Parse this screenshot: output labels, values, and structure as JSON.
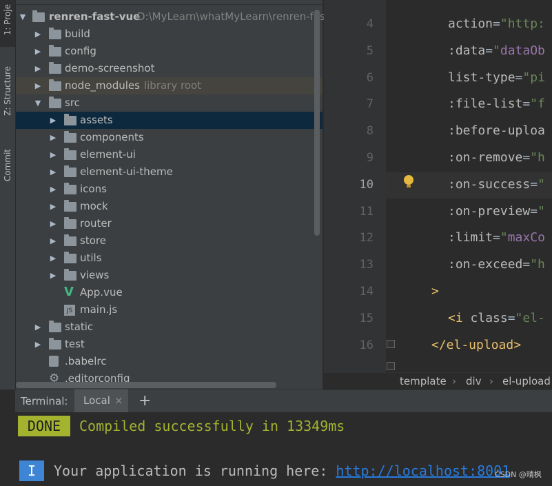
{
  "toolstrip": {
    "tabs": [
      {
        "label": "1: Proje"
      },
      {
        "label": "Z: Structure"
      },
      {
        "label": "Commit"
      }
    ]
  },
  "project": {
    "root": {
      "name": "renren-fast-vue",
      "path": "D:\\MyLearn\\whatMyLearn\\renren-fast"
    },
    "items": [
      {
        "label": "build",
        "kind": "folder"
      },
      {
        "label": "config",
        "kind": "folder"
      },
      {
        "label": "demo-screenshot",
        "kind": "folder"
      },
      {
        "label": "node_modules",
        "kind": "folder",
        "hint": "library root"
      },
      {
        "label": "src",
        "kind": "folder"
      },
      {
        "label": "assets",
        "kind": "folder"
      },
      {
        "label": "components",
        "kind": "folder"
      },
      {
        "label": "element-ui",
        "kind": "folder"
      },
      {
        "label": "element-ui-theme",
        "kind": "folder"
      },
      {
        "label": "icons",
        "kind": "folder"
      },
      {
        "label": "mock",
        "kind": "folder"
      },
      {
        "label": "router",
        "kind": "folder"
      },
      {
        "label": "store",
        "kind": "folder"
      },
      {
        "label": "utils",
        "kind": "folder"
      },
      {
        "label": "views",
        "kind": "folder"
      },
      {
        "label": "App.vue",
        "kind": "vue-file"
      },
      {
        "label": "main.js",
        "kind": "js-file"
      },
      {
        "label": "static",
        "kind": "folder"
      },
      {
        "label": "test",
        "kind": "folder"
      },
      {
        "label": ".babelrc",
        "kind": "config-file"
      },
      {
        "label": ".editorconfig",
        "kind": "gear-file"
      }
    ]
  },
  "editor": {
    "current_line": "10",
    "lines": [
      {
        "num": "4",
        "parts": [
          [
            "attr",
            "action"
          ],
          [
            "eq",
            "="
          ],
          [
            "str",
            "\"http:"
          ]
        ]
      },
      {
        "num": "5",
        "parts": [
          [
            "attr",
            ":data"
          ],
          [
            "eq",
            "="
          ],
          [
            "str",
            "\""
          ],
          [
            "dyn",
            "dataOb"
          ]
        ]
      },
      {
        "num": "6",
        "parts": [
          [
            "attr",
            "list-type"
          ],
          [
            "eq",
            "="
          ],
          [
            "str",
            "\"pi"
          ]
        ]
      },
      {
        "num": "7",
        "parts": [
          [
            "attr",
            ":file-list"
          ],
          [
            "eq",
            "="
          ],
          [
            "str",
            "\"f"
          ]
        ]
      },
      {
        "num": "8",
        "parts": [
          [
            "attr",
            ":before-uploa"
          ]
        ]
      },
      {
        "num": "9",
        "parts": [
          [
            "attr",
            ":on-remove"
          ],
          [
            "eq",
            "="
          ],
          [
            "str",
            "\"h"
          ]
        ]
      },
      {
        "num": "10",
        "parts": [
          [
            "attr",
            ":on-success"
          ],
          [
            "eq",
            "="
          ],
          [
            "str",
            "\""
          ]
        ]
      },
      {
        "num": "11",
        "parts": [
          [
            "attr",
            ":on-preview"
          ],
          [
            "eq",
            "="
          ],
          [
            "str",
            "\""
          ]
        ]
      },
      {
        "num": "12",
        "parts": [
          [
            "attr",
            ":limit"
          ],
          [
            "eq",
            "="
          ],
          [
            "str",
            "\""
          ],
          [
            "dyn",
            "maxCo"
          ]
        ]
      },
      {
        "num": "13",
        "parts": [
          [
            "attr",
            ":on-exceed"
          ],
          [
            "eq",
            "="
          ],
          [
            "str",
            "\"h"
          ]
        ]
      },
      {
        "num": "14",
        "parts": [
          [
            "tag",
            ">"
          ]
        ]
      },
      {
        "num": "15",
        "parts": [
          [
            "tag",
            "<i "
          ],
          [
            "attr",
            "class"
          ],
          [
            "eq",
            "="
          ],
          [
            "str",
            "\"el-"
          ]
        ]
      },
      {
        "num": "16",
        "parts": [
          [
            "tag",
            "</el-upload>"
          ]
        ]
      }
    ]
  },
  "breadcrumb": [
    "template",
    "div",
    "el-upload"
  ],
  "terminal": {
    "title": "Terminal:",
    "tab_label": "Local",
    "close_glyph": "×",
    "add_glyph": "+",
    "done_badge": "DONE",
    "done_text": "Compiled successfully in 13349ms",
    "info_badge": "I",
    "info_text": "Your application is running here: ",
    "url": "http://localhost:8001"
  },
  "watermark": "CSDN @晴枫",
  "colors": {
    "selection": "#0d293e",
    "done": "#a3b330",
    "info": "#3f85d6",
    "link": "#287bde"
  }
}
